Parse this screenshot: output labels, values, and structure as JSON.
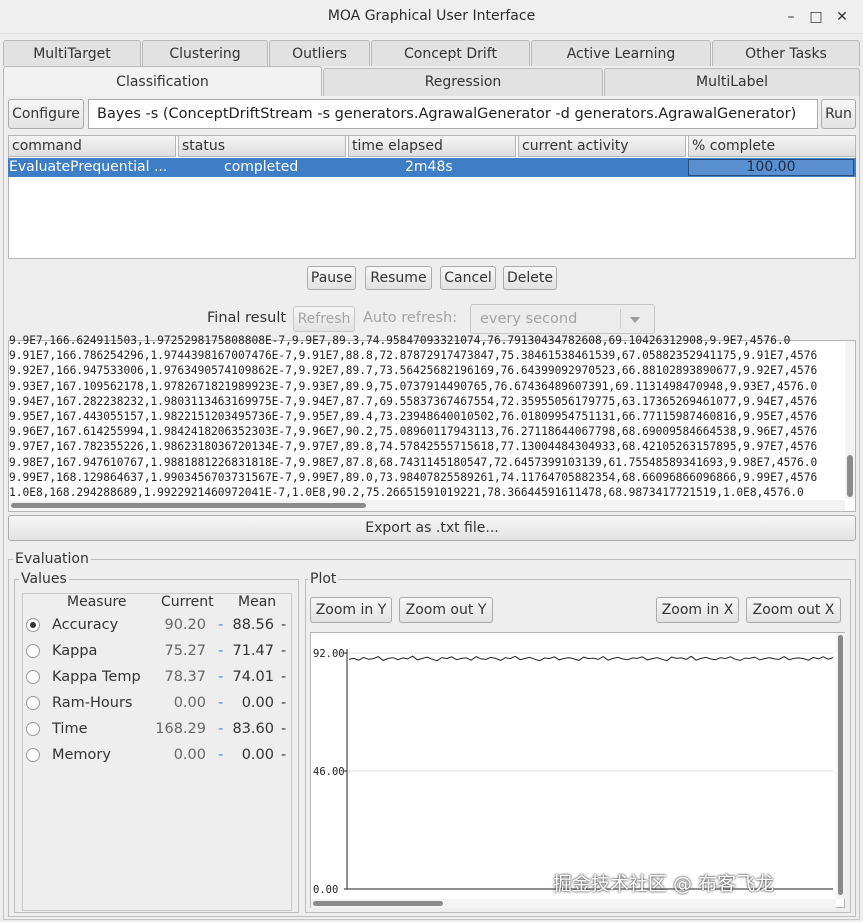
{
  "window": {
    "title": "MOA Graphical User Interface",
    "minimize": "–",
    "maximize": "□",
    "close": "✕"
  },
  "tabs_row1": [
    "MultiTarget",
    "Clustering",
    "Outliers",
    "Concept Drift",
    "Active Learning",
    "Other Tasks"
  ],
  "tabs_row2": [
    "Classification",
    "Regression",
    "MultiLabel"
  ],
  "toolbar": {
    "configure_label": "Configure",
    "command_text": "Bayes -s (ConceptDriftStream -s generators.AgrawalGenerator -d generators.AgrawalGenerator)",
    "run_label": "Run"
  },
  "task_table": {
    "columns": [
      "command",
      "status",
      "time elapsed",
      "current activity",
      "% complete"
    ],
    "rows": [
      {
        "command": "EvaluatePrequential ...",
        "status": "completed",
        "time_elapsed": "2m48s",
        "current_activity": "",
        "percent_complete": "100.00",
        "progress_fraction": 1.0
      }
    ]
  },
  "task_buttons": {
    "pause": "Pause",
    "resume": "Resume",
    "cancel": "Cancel",
    "delete": "Delete"
  },
  "result_bar": {
    "final_result_label": "Final result",
    "refresh_label": "Refresh",
    "auto_refresh_label": "Auto refresh:",
    "auto_refresh_value": "every second"
  },
  "log_lines": [
    "9.9E7,166.624911503,1.9725298175808808E-7,9.9E7,89.3,74.95847093321074,76.79130434782608,69.10426312908,9.9E7,4576.0",
    "9.91E7,166.786254296,1.9744398167007476E-7,9.91E7,88.8,72.87872917473847,75.38461538461539,67.05882352941175,9.91E7,4576",
    "9.92E7,166.947533006,1.9763490574109862E-7,9.92E7,89.7,73.56425682196169,76.64399092970523,66.88102893890677,9.92E7,4576",
    "9.93E7,167.109562178,1.9782671821989923E-7,9.93E7,89.9,75.0737914490765,76.67436489607391,69.1131498470948,9.93E7,4576.0",
    "9.94E7,167.282238232,1.9803113463169975E-7,9.94E7,87.7,69.55837367467554,72.35955056179775,63.17365269461077,9.94E7,4576",
    "9.95E7,167.443055157,1.9822151203495736E-7,9.95E7,89.4,73.23948640010502,76.01809954751131,66.77115987460816,9.95E7,4576",
    "9.96E7,167.614255994,1.9842418206352303E-7,9.96E7,90.2,75.08960117943113,76.27118644067798,68.69009584664538,9.96E7,4576",
    "9.97E7,167.782355226,1.9862318036720134E-7,9.97E7,89.8,74.57842555715618,77.13004484304933,68.42105263157895,9.97E7,4576",
    "9.98E7,167.947610767,1.9881881226831818E-7,9.98E7,87.8,68.7431145180547,72.6457399103139,61.75548589341693,9.98E7,4576.0",
    "9.99E7,168.129864637,1.9903456703731567E-7,9.99E7,89.0,73.98407825589261,74.11764705882354,68.66096866096866,9.99E7,4576",
    "1.0E8,168.294288689,1.9922921460972041E-7,1.0E8,90.2,75.26651591019221,78.36644591611478,68.9873417721519,1.0E8,4576.0"
  ],
  "export_label": "Export as .txt file...",
  "evaluation": {
    "title": "Evaluation",
    "values_title": "Values",
    "plot_title": "Plot",
    "headers": {
      "measure": "Measure",
      "current": "Current",
      "mean": "Mean"
    },
    "dash": "-",
    "measures": [
      {
        "name": "Accuracy",
        "current": "90.20",
        "mean": "88.56",
        "selected": true
      },
      {
        "name": "Kappa",
        "current": "75.27",
        "mean": "71.47",
        "selected": false
      },
      {
        "name": "Kappa Temp",
        "current": "78.37",
        "mean": "74.01",
        "selected": false
      },
      {
        "name": "Ram-Hours",
        "current": "0.00",
        "mean": "0.00",
        "selected": false
      },
      {
        "name": "Time",
        "current": "168.29",
        "mean": "83.60",
        "selected": false
      },
      {
        "name": "Memory",
        "current": "0.00",
        "mean": "0.00",
        "selected": false
      }
    ],
    "zoom": {
      "in_y": "Zoom in Y",
      "out_y": "Zoom out Y",
      "in_x": "Zoom in X",
      "out_x": "Zoom out X"
    }
  },
  "chart_data": {
    "type": "line",
    "title": "",
    "xlabel": "",
    "ylabel": "",
    "y_tick_labels": [
      "92.00",
      "46.00",
      "0.00"
    ],
    "ylim": [
      0,
      92
    ],
    "grid": true,
    "series": [
      {
        "values": [
          89.6,
          89.9,
          89.2,
          90.3,
          89.5,
          89.8,
          90.6,
          89.1,
          89.9,
          90.2,
          89.4,
          90.1,
          89.7,
          90.8,
          89.3,
          89.9,
          90.4,
          89.6,
          89.0,
          90.2,
          89.8,
          90.5,
          89.4,
          89.9,
          90.1,
          89.2,
          90.6,
          89.7,
          89.5,
          90.3,
          89.9,
          89.1,
          90.2,
          89.8,
          90.7,
          89.4,
          89.9,
          90.3,
          89.6,
          89.0,
          90.1,
          89.8,
          90.5,
          89.3,
          89.9,
          90.2,
          89.7,
          89.1,
          90.4,
          89.8,
          90.0,
          89.5,
          90.6,
          89.2,
          89.9,
          90.3,
          89.7,
          89.4,
          90.1,
          89.9,
          90.5,
          89.3,
          89.8,
          90.2,
          89.6,
          89.0,
          90.4,
          89.9,
          90.1,
          89.5,
          90.7,
          89.2,
          89.9,
          90.3,
          89.7,
          89.4,
          90.2,
          89.8,
          90.5,
          89.6,
          89.1,
          90.0,
          89.9,
          90.4,
          89.3,
          89.8,
          90.2,
          89.7,
          89.5,
          90.6,
          89.4,
          89.9,
          90.1,
          89.8,
          89.2,
          90.3,
          89.7,
          90.5,
          89.6,
          90.2
        ]
      }
    ]
  },
  "watermark": "掘金技术社区 @ 布客飞龙"
}
